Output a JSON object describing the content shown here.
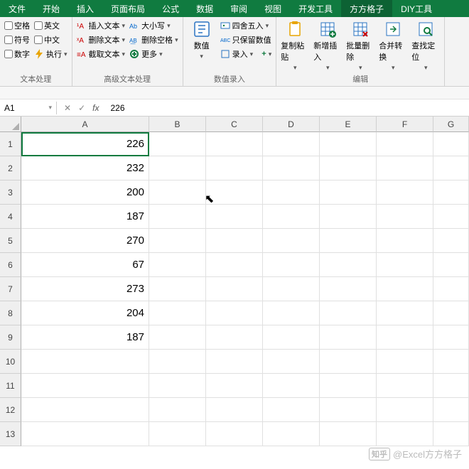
{
  "tabs": [
    "文件",
    "开始",
    "插入",
    "页面布局",
    "公式",
    "数据",
    "审阅",
    "视图",
    "开发工具",
    "方方格子",
    "DIY工具"
  ],
  "active_tab": "方方格子",
  "ribbon": {
    "g1": {
      "label": "文本处理",
      "checks": [
        "空格",
        "英文",
        "符号",
        "中文",
        "数字",
        "执行"
      ],
      "exec_arrow": "▾"
    },
    "g2": {
      "label": "高级文本处理",
      "b1": "插入文本",
      "b2": "删除文本",
      "b3": "截取文本",
      "b4": "大小写",
      "b5": "删除空格",
      "b6": "更多"
    },
    "g3": {
      "label": "数值录入",
      "big": "数值",
      "r1": "四舍五入",
      "r2": "只保留数值",
      "r3": "录入",
      "plus": "+"
    },
    "g4": {
      "label": "编辑",
      "b1": "复制粘贴",
      "b2": "新增插入",
      "b3": "批量删除",
      "b4": "合并转换",
      "b5": "查找定位"
    }
  },
  "namebox": "A1",
  "formula": "226",
  "columns": [
    "A",
    "B",
    "C",
    "D",
    "E",
    "F",
    "G"
  ],
  "rows": [
    "1",
    "2",
    "3",
    "4",
    "5",
    "6",
    "7",
    "8",
    "9",
    "10",
    "11",
    "12",
    "13"
  ],
  "data": {
    "A": [
      "226",
      "232",
      "200",
      "187",
      "270",
      "67",
      "273",
      "204",
      "187",
      "",
      "",
      "",
      ""
    ]
  },
  "watermark": {
    "z": "知乎",
    "at": "@Excel方方格子"
  }
}
